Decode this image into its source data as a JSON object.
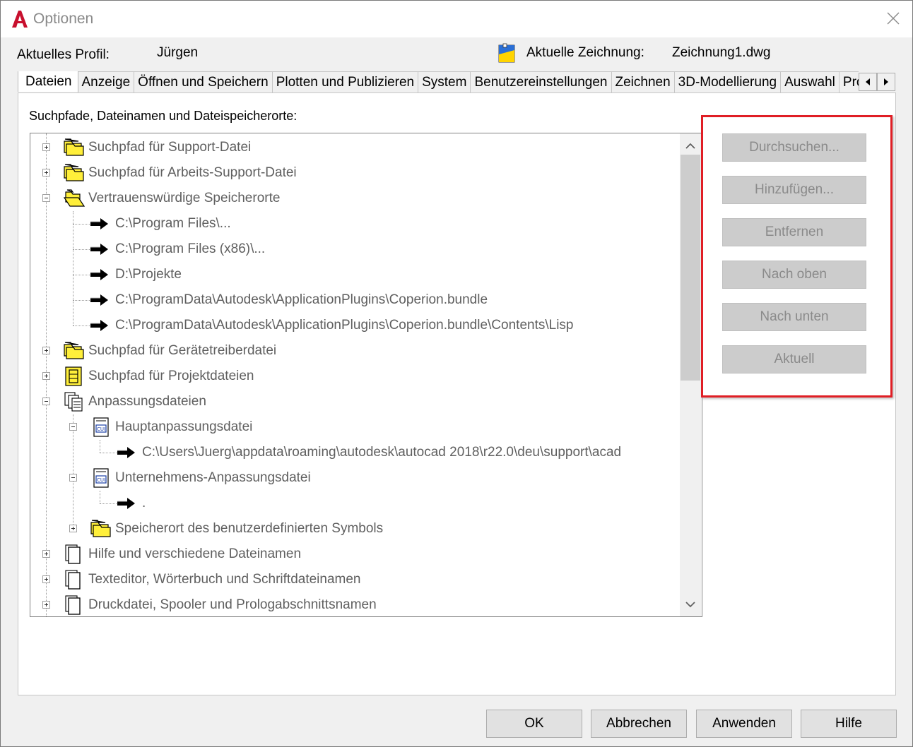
{
  "window": {
    "title": "Optionen",
    "close_icon": "close-icon",
    "app_icon": "autocad-logo-icon"
  },
  "profile": {
    "label": "Aktuelles Profil:",
    "value": "Jürgen"
  },
  "drawing": {
    "label": "Aktuelle Zeichnung:",
    "value": "Zeichnung1.dwg"
  },
  "tabs": [
    {
      "label": "Dateien",
      "active": true
    },
    {
      "label": "Anzeige"
    },
    {
      "label": "Öffnen und Speichern"
    },
    {
      "label": "Plotten und Publizieren"
    },
    {
      "label": "System"
    },
    {
      "label": "Benutzereinstellungen"
    },
    {
      "label": "Zeichnen"
    },
    {
      "label": "3D-Modellierung"
    },
    {
      "label": "Auswahl"
    },
    {
      "label": "Profile"
    }
  ],
  "section_label": "Suchpfade, Dateinamen und Dateispeicherorte:",
  "tree": [
    {
      "label": "Suchpfad für Support-Datei",
      "icon": "folder-stack-icon",
      "expanded": false
    },
    {
      "label": "Suchpfad für Arbeits-Support-Datei",
      "icon": "folder-stack-icon",
      "expanded": false
    },
    {
      "label": "Vertrauenswürdige Speicherorte",
      "icon": "folder-open-stack-icon",
      "expanded": true
    },
    {
      "label": "C:\\Program Files\\...",
      "icon": "arrow-right-icon"
    },
    {
      "label": "C:\\Program Files (x86)\\...",
      "icon": "arrow-right-icon"
    },
    {
      "label": "D:\\Projekte",
      "icon": "arrow-right-icon"
    },
    {
      "label": "C:\\ProgramData\\Autodesk\\ApplicationPlugins\\Coperion.bundle",
      "icon": "arrow-right-icon"
    },
    {
      "label": "C:\\ProgramData\\Autodesk\\ApplicationPlugins\\Coperion.bundle\\Contents\\Lisp",
      "icon": "arrow-right-icon"
    },
    {
      "label": "Suchpfad für Gerätetreiberdatei",
      "icon": "folder-stack-icon",
      "expanded": false
    },
    {
      "label": "Suchpfad für Projektdateien",
      "icon": "project-file-icon",
      "expanded": false
    },
    {
      "label": "Anpassungsdateien",
      "icon": "documents-icon",
      "expanded": true
    },
    {
      "label": "Hauptanpassungsdatei",
      "icon": "cui-file-icon",
      "expanded": true
    },
    {
      "label": "C:\\Users\\Juerg\\appdata\\roaming\\autodesk\\autocad 2018\\r22.0\\deu\\support\\acad",
      "icon": "arrow-right-icon"
    },
    {
      "label": "Unternehmens-Anpassungsdatei",
      "icon": "cui-file-icon",
      "expanded": true
    },
    {
      "label": ".",
      "icon": "arrow-right-icon"
    },
    {
      "label": "Speicherort des benutzerdefinierten Symbols",
      "icon": "folder-stack-icon",
      "expanded": false
    },
    {
      "label": "Hilfe und verschiedene Dateinamen",
      "icon": "document-stack-icon",
      "expanded": false
    },
    {
      "label": "Texteditor, Wörterbuch und Schriftdateinamen",
      "icon": "document-stack-icon",
      "expanded": false
    },
    {
      "label": "Druckdatei, Spooler und Prologabschnittsnamen",
      "icon": "document-stack-icon",
      "expanded": false
    }
  ],
  "side_buttons": {
    "browse": "Durchsuchen...",
    "add": "Hinzufügen...",
    "remove": "Entfernen",
    "move_up": "Nach oben",
    "move_down": "Nach unten",
    "current": "Aktuell"
  },
  "bottom_buttons": {
    "ok": "OK",
    "cancel": "Abbrechen",
    "apply": "Anwenden",
    "help": "Hilfe"
  },
  "colors": {
    "highlight": "#e01e25",
    "disabled_text": "#8a8a8a",
    "folder_yellow": "#ffef3a"
  }
}
